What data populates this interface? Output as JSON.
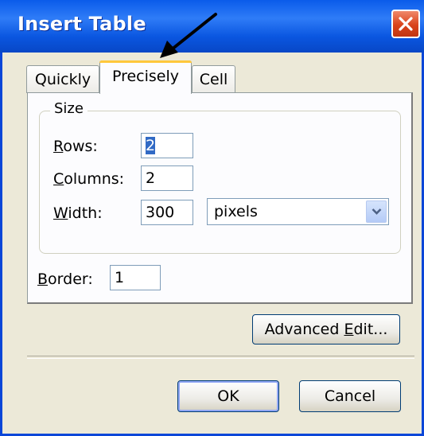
{
  "window": {
    "title": "Insert Table"
  },
  "tabs": [
    {
      "label": "Quickly",
      "active": false
    },
    {
      "label": "Precisely",
      "active": true
    },
    {
      "label": "Cell",
      "active": false
    }
  ],
  "size_group": {
    "legend": "Size",
    "rows": {
      "label_accel": "R",
      "label_rest": "ows:",
      "value": "2"
    },
    "columns": {
      "label_accel": "C",
      "label_rest": "olumns:",
      "value": "2"
    },
    "width": {
      "label_accel": "W",
      "label_rest": "idth:",
      "value": "300",
      "unit": "pixels"
    }
  },
  "border": {
    "label_accel": "B",
    "label_rest": "order:",
    "value": "1"
  },
  "buttons": {
    "advanced_pre": "Advanced ",
    "advanced_accel": "E",
    "advanced_post": "dit...",
    "ok": "OK",
    "cancel": "Cancel"
  },
  "colors": {
    "titlebar": "#0a5bea",
    "dialog_bg": "#ece9d8",
    "close": "#d9431b"
  }
}
